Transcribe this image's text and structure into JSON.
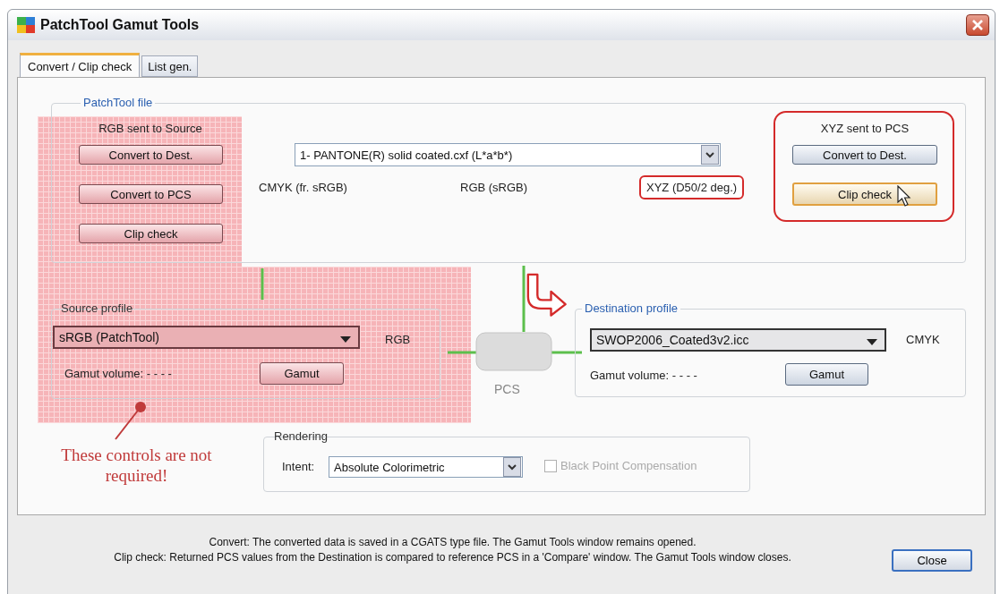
{
  "window": {
    "title": "PatchTool Gamut Tools"
  },
  "tabs": [
    {
      "label": "Convert / Clip check",
      "selected": true
    },
    {
      "label": "List gen.",
      "selected": false
    }
  ],
  "patchtool_file": {
    "legend": "PatchTool file",
    "source_heading": "RGB sent to Source",
    "source_buttons": [
      "Convert to Dest.",
      "Convert to PCS",
      "Clip check"
    ],
    "file_select": {
      "value": "1- PANTONE(R) solid coated.cxf (L*a*b*)"
    },
    "color_spaces": [
      {
        "label": "CMYK (fr. sRGB)",
        "highlighted": false
      },
      {
        "label": "RGB (sRGB)",
        "highlighted": false
      },
      {
        "label": "XYZ (D50/2 deg.)",
        "highlighted": true
      }
    ],
    "pcs_heading": "XYZ sent to PCS",
    "pcs_buttons": [
      {
        "label": "Convert to Dest.",
        "focused": false
      },
      {
        "label": "Clip check",
        "focused": true
      }
    ]
  },
  "source_profile": {
    "legend": "Source profile",
    "value": "sRGB (PatchTool)",
    "color_space": "RGB",
    "gamut_volume": "Gamut volume:  - - - -",
    "gamut_button": "Gamut"
  },
  "pcs_diagram": {
    "label": "PCS"
  },
  "destination_profile": {
    "legend": "Destination profile",
    "value": "SWOP2006_Coated3v2.icc",
    "color_space": "CMYK",
    "gamut_volume": "Gamut volume:  - - - -",
    "gamut_button": "Gamut"
  },
  "rendering": {
    "legend": "Rendering",
    "intent_label": "Intent:",
    "intent": "Absolute Colorimetric",
    "black_point": {
      "label": "Black Point Compensation",
      "checked": false,
      "disabled": true
    }
  },
  "annotation": {
    "text": "These controls are not required!"
  },
  "info_lines": [
    "Convert: The converted data is saved in a CGATS type file. The Gamut Tools window remains opened.",
    "Clip check: Returned PCS values from the Destination is compared to reference PCS in a 'Compare' window. The Gamut Tools window closes."
  ],
  "close_button": "Close"
}
